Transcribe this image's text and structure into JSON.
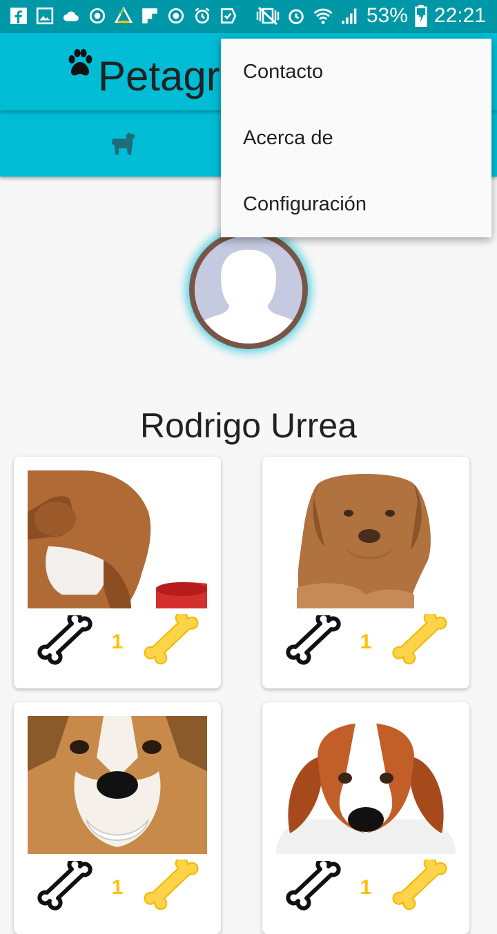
{
  "status_bar": {
    "battery": "53%",
    "time": "22:21"
  },
  "app_bar": {
    "title": "Petagram",
    "logo_icon": "paw-icon"
  },
  "tabs": [
    {
      "icon": "dog-icon"
    }
  ],
  "menu": {
    "items": [
      {
        "label": "Contacto"
      },
      {
        "label": "Acerca de"
      },
      {
        "label": "Configuración"
      }
    ]
  },
  "profile": {
    "name": "Rodrigo Urrea",
    "avatar_icon": "default-avatar-icon"
  },
  "pets": [
    {
      "likes": "1",
      "photo": "bulldog-photo"
    },
    {
      "likes": "1",
      "photo": "mastiff-puppy-photo"
    },
    {
      "likes": "1",
      "photo": "smiling-dog-photo"
    },
    {
      "likes": "1",
      "photo": "beagle-photo"
    }
  ],
  "colors": {
    "primary": "#00bcd4",
    "primary_dark": "#0097a7",
    "accent": "#ffc107",
    "avatar_border": "#795548"
  }
}
